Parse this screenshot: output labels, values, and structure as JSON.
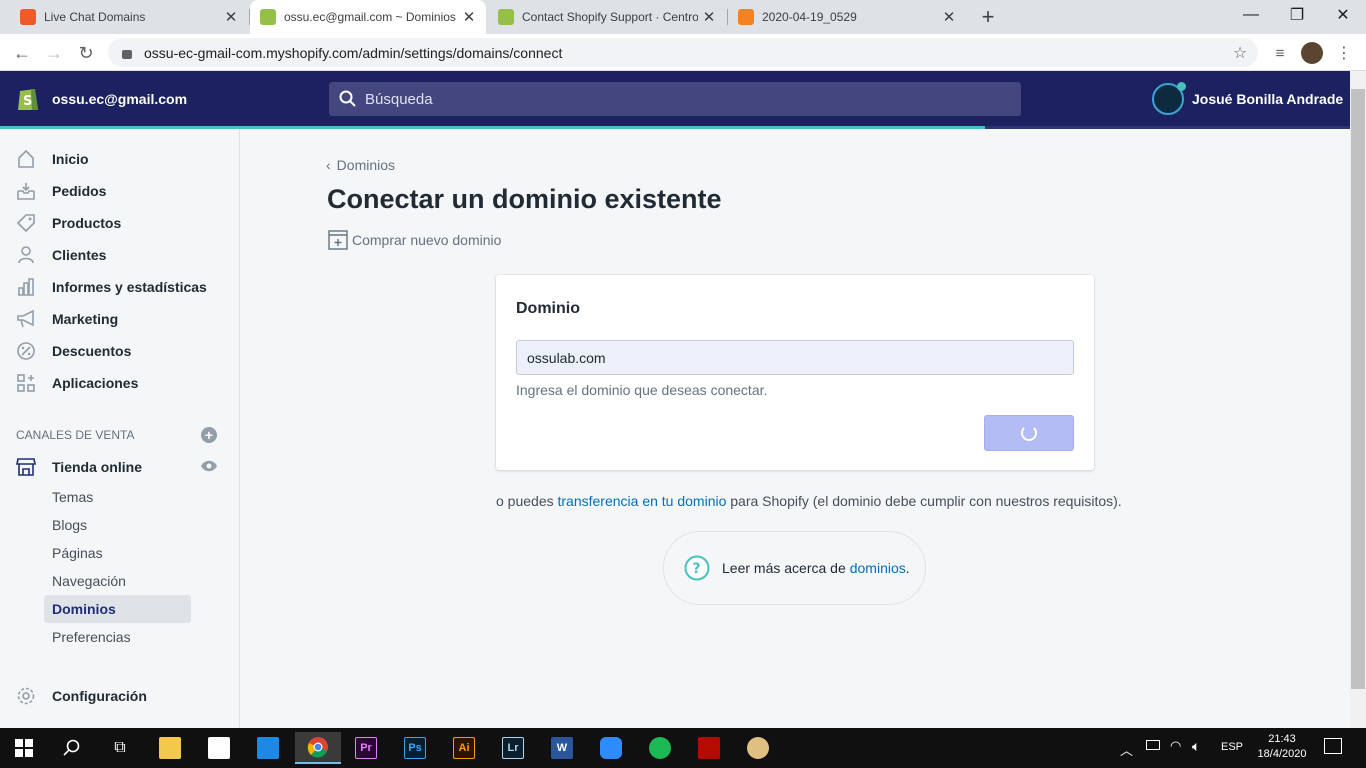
{
  "browser": {
    "tabs": [
      {
        "title": "Live Chat Domains",
        "favicon_color": "#f05a28",
        "active": false
      },
      {
        "title": "ossu.ec@gmail.com ~ Dominios",
        "favicon_color": "#95bf47",
        "active": true
      },
      {
        "title": "Contact Shopify Support · Centro",
        "favicon_color": "#95bf47",
        "active": false
      },
      {
        "title": "2020-04-19_0529",
        "favicon_color": "#f58220",
        "active": false
      }
    ],
    "url": "ossu-ec-gmail-com.myshopify.com/admin/settings/domains/connect",
    "new_tab_label": "+"
  },
  "topbar": {
    "store_name": "ossu.ec@gmail.com",
    "search_placeholder": "Búsqueda",
    "user_name": "Josué Bonilla Andrade",
    "brand_color": "#1c2260",
    "accent_color": "#47c1bf"
  },
  "sidebar": {
    "items": [
      {
        "label": "Inicio",
        "icon": "home-icon"
      },
      {
        "label": "Pedidos",
        "icon": "orders-icon"
      },
      {
        "label": "Productos",
        "icon": "tag-icon"
      },
      {
        "label": "Clientes",
        "icon": "person-icon"
      },
      {
        "label": "Informes y estadísticas",
        "icon": "analytics-icon"
      },
      {
        "label": "Marketing",
        "icon": "megaphone-icon"
      },
      {
        "label": "Descuentos",
        "icon": "discount-icon"
      },
      {
        "label": "Aplicaciones",
        "icon": "apps-icon"
      }
    ],
    "channels_heading": "CANALES DE VENTA",
    "online_store": "Tienda online",
    "subitems": [
      "Temas",
      "Blogs",
      "Páginas",
      "Navegación",
      "Dominios",
      "Preferencias"
    ],
    "selected_subitem": "Dominios",
    "settings": "Configuración"
  },
  "main": {
    "breadcrumb": "Dominios",
    "page_title": "Conectar un dominio existente",
    "buy_domain": "Comprar nuevo dominio",
    "card": {
      "heading": "Dominio",
      "input_value": "ossulab.com",
      "help_text": "Ingresa el dominio que deseas conectar."
    },
    "transfer_prefix": "o puedes ",
    "transfer_link": "transferencia en tu dominio",
    "transfer_suffix": " para Shopify (el dominio debe cumplir con nuestros requisitos).",
    "learn_prefix": "Leer más acerca de ",
    "learn_link": "dominios",
    "learn_suffix": "."
  },
  "taskbar": {
    "apps": [
      "file-explorer-icon",
      "store-icon",
      "mail-icon",
      "chrome-icon",
      "premiere-icon",
      "photoshop-icon",
      "illustrator-icon",
      "lightroom-icon",
      "word-icon",
      "zoom-icon",
      "spotify-icon",
      "acrobat-icon",
      "paint-icon"
    ],
    "labels": {
      "premiere": "Pr",
      "photoshop": "Ps",
      "illustrator": "Ai",
      "lightroom": "Lr",
      "word": "W"
    },
    "lang": "ESP",
    "time": "21:43",
    "date": "18/4/2020"
  }
}
